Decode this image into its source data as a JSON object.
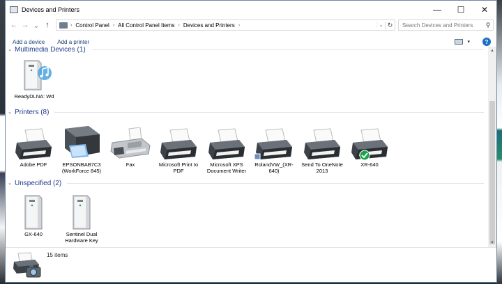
{
  "window": {
    "title": "Devices and Printers",
    "minimize_glyph": "—",
    "maximize_glyph": "☐",
    "close_glyph": "✕"
  },
  "nav": {
    "back_glyph": "←",
    "forward_glyph": "→",
    "recent_glyph": "⌄",
    "up_glyph": "↑"
  },
  "address": {
    "sep": "›",
    "crumbs": [
      "Control Panel",
      "All Control Panel Items",
      "Devices and Printers"
    ],
    "dropdown_glyph": "⌄",
    "refresh_glyph": "↻"
  },
  "search": {
    "placeholder": "Search Devices and Printers",
    "icon_glyph": "⚲"
  },
  "commands": {
    "add_device": "Add a device",
    "add_printer": "Add a printer",
    "view_drop_glyph": "▾",
    "help_glyph": "?"
  },
  "groups": {
    "multimedia": {
      "title": "Multimedia Devices (1)",
      "chevron": "⌄"
    },
    "printers": {
      "title": "Printers (8)",
      "chevron": "⌄"
    },
    "unspecified": {
      "title": "Unspecified (2)",
      "chevron": "⌄"
    }
  },
  "devices": {
    "multimedia": [
      {
        "label": "ReadyDLNA: Wd",
        "icon": "media-server-icon"
      }
    ],
    "printers": [
      {
        "label": "Adobe PDF",
        "icon": "printer-icon"
      },
      {
        "label": "EPSONBAB7C3 (WorkForce 845)",
        "icon": "multifunction-printer-icon"
      },
      {
        "label": "Fax",
        "icon": "fax-icon"
      },
      {
        "label": "Microsoft Print to PDF",
        "icon": "printer-icon"
      },
      {
        "label": "Microsoft XPS Document Writer",
        "icon": "printer-icon"
      },
      {
        "label": "RolandVW_(XR-640)",
        "icon": "printer-icon"
      },
      {
        "label": "Send To OneNote 2013",
        "icon": "printer-icon"
      },
      {
        "label": "XR-640",
        "icon": "default-printer-icon",
        "default": true
      }
    ],
    "unspecified": [
      {
        "label": "GX-640",
        "icon": "tower-device-icon"
      },
      {
        "label": "Sentinel Dual Hardware Key",
        "icon": "tower-device-icon"
      }
    ]
  },
  "status": {
    "count": "15 items",
    "icon": "devices-and-printers-icon"
  },
  "colors": {
    "group_title": "#1e3c8c",
    "command_link": "#1a3e74",
    "default_check": "#1aa34a",
    "help": "#1c6fc7"
  }
}
